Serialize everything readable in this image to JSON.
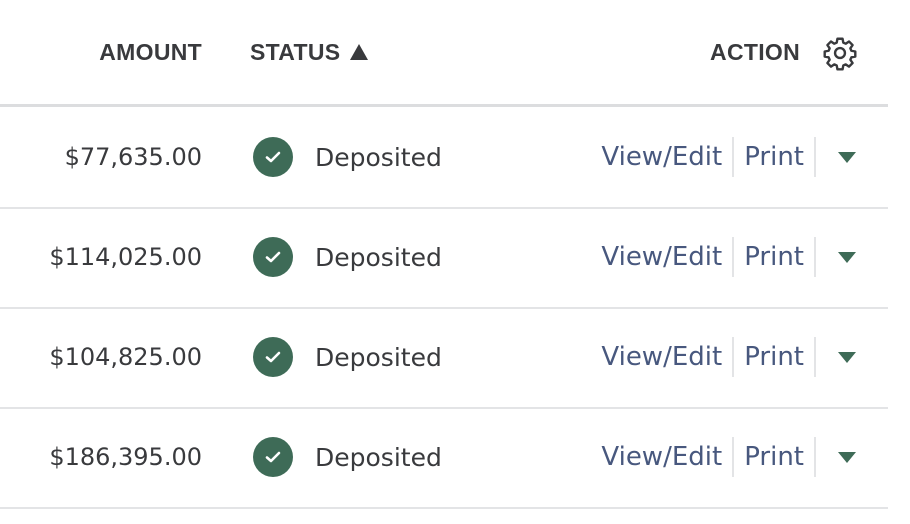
{
  "header": {
    "amount": "AMOUNT",
    "status": "STATUS",
    "action": "ACTION",
    "sort_direction": "ascending"
  },
  "rows": [
    {
      "amount": "$77,635.00",
      "status": "Deposited",
      "view_edit": "View/Edit",
      "print": "Print"
    },
    {
      "amount": "$114,025.00",
      "status": "Deposited",
      "view_edit": "View/Edit",
      "print": "Print"
    },
    {
      "amount": "$104,825.00",
      "status": "Deposited",
      "view_edit": "View/Edit",
      "print": "Print"
    },
    {
      "amount": "$186,395.00",
      "status": "Deposited",
      "view_edit": "View/Edit",
      "print": "Print"
    }
  ],
  "colors": {
    "status_green": "#3e6b57",
    "link_blue": "#48587e",
    "text": "#393a3d",
    "divider": "#e3e4e6"
  },
  "icons": {
    "sort": "triangle-up-icon",
    "settings": "gear-icon",
    "status": "check-circle-icon",
    "more": "caret-down-icon"
  }
}
